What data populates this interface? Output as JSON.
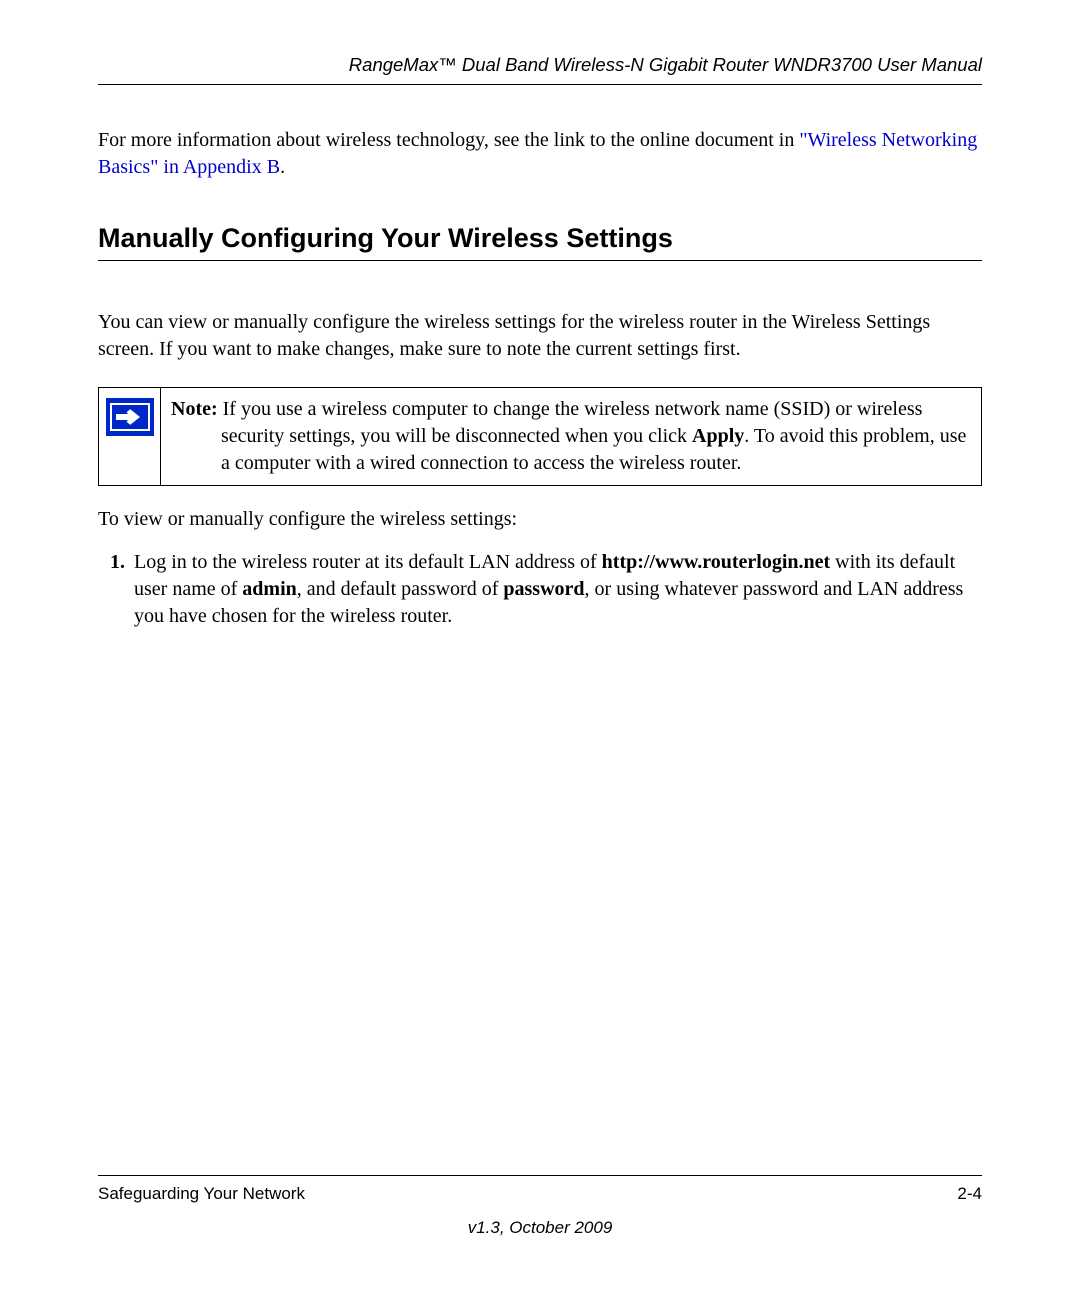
{
  "header": {
    "title": "RangeMax™ Dual Band Wireless-N Gigabit Router WNDR3700 User Manual"
  },
  "intro": {
    "prefix": "For more information about wireless technology, see the link to the online document in ",
    "link_text": "\"Wireless Networking Basics\" in Appendix B",
    "suffix": "."
  },
  "section": {
    "heading": "Manually Configuring Your Wireless Settings"
  },
  "para1": "You can view or manually configure the wireless settings for the wireless router in the Wireless Settings screen. If you want to make changes, make sure to note the current settings first.",
  "note": {
    "label": "Note:",
    "text1": " If you use a wireless computer to change the wireless network name (SSID) or wireless security settings, you will be disconnected when you click ",
    "bold1": "Apply",
    "text2": ". To avoid this problem, use a computer with a wired connection to access the wireless router."
  },
  "instr": "To view or manually configure the wireless settings:",
  "list": {
    "item1": {
      "t1": "Log in to the wireless router at its default LAN address of ",
      "b1": "http://www.routerlogin.net",
      "t2": " with its default user name of ",
      "b2": "admin",
      "t3": ", and default password of ",
      "b3": "password",
      "t4": ", or using whatever password and LAN address you have chosen for the wireless router."
    }
  },
  "footer": {
    "left": "Safeguarding Your Network",
    "right": "2-4",
    "version": "v1.3, October 2009"
  }
}
